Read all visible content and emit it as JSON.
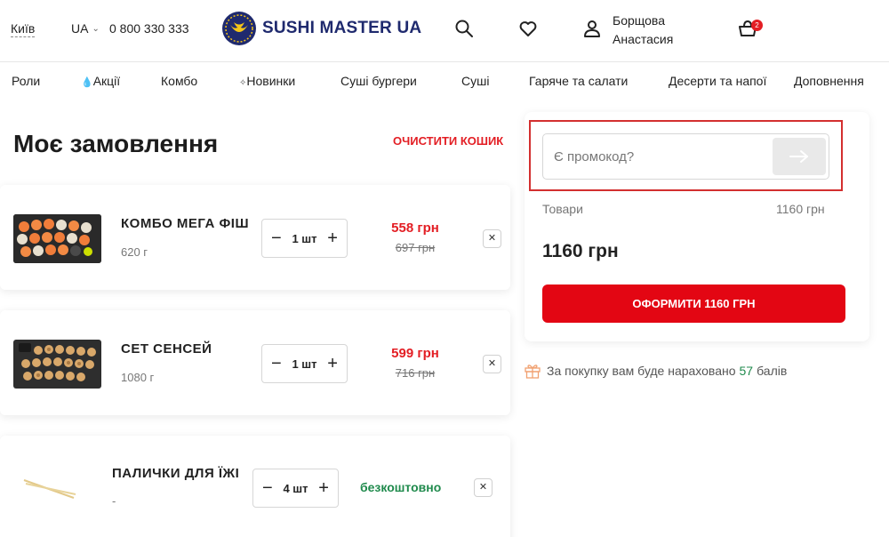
{
  "header": {
    "city": "Київ",
    "lang": "UA",
    "phone": "0 800 330 333",
    "brand": "SUSHI MASTER UA",
    "user_first": "Борщова",
    "user_last": "Анастасия",
    "cart_count": "2",
    "icons": [
      "search-icon",
      "heart-icon",
      "user-icon",
      "basket-icon"
    ]
  },
  "nav": {
    "items": [
      "Роли",
      "Акції",
      "Комбо",
      "Новинки",
      "Суші бургери",
      "Суші",
      "Гаряче та салати",
      "Десерти та напої",
      "Доповнення"
    ]
  },
  "order": {
    "title": "Моє замовлення",
    "clear_label": "ОЧИСТИТИ КОШИК",
    "items": [
      {
        "name": "КОМБО МЕГА ФІШ",
        "weight": "620 г",
        "qty": "1 шт",
        "price": "558 грн",
        "old_price": "697 грн"
      },
      {
        "name": "СЕТ СЕНСЕЙ",
        "weight": "1080 г",
        "qty": "1 шт",
        "price": "599 грн",
        "old_price": "716 грн"
      },
      {
        "name": "ПАЛИЧКИ ДЛЯ ЇЖІ",
        "weight": "-",
        "qty": "4 шт",
        "price": "безкоштовно"
      }
    ]
  },
  "summary": {
    "promo_placeholder": "Є промокод?",
    "goods_label": "Товари",
    "goods_value": "1160 грн",
    "total": "1160 грн",
    "checkout_label": "ОФОРМИТИ 1160 ГРН",
    "bonus_prefix": "За покупку вам буде нараховано",
    "bonus_points": "57",
    "bonus_suffix": "балів"
  },
  "colors": {
    "accent": "#e31e24",
    "brand_navy": "#1f2a6e",
    "brand_yellow": "#f5c518",
    "free_green": "#1f8a4c"
  }
}
